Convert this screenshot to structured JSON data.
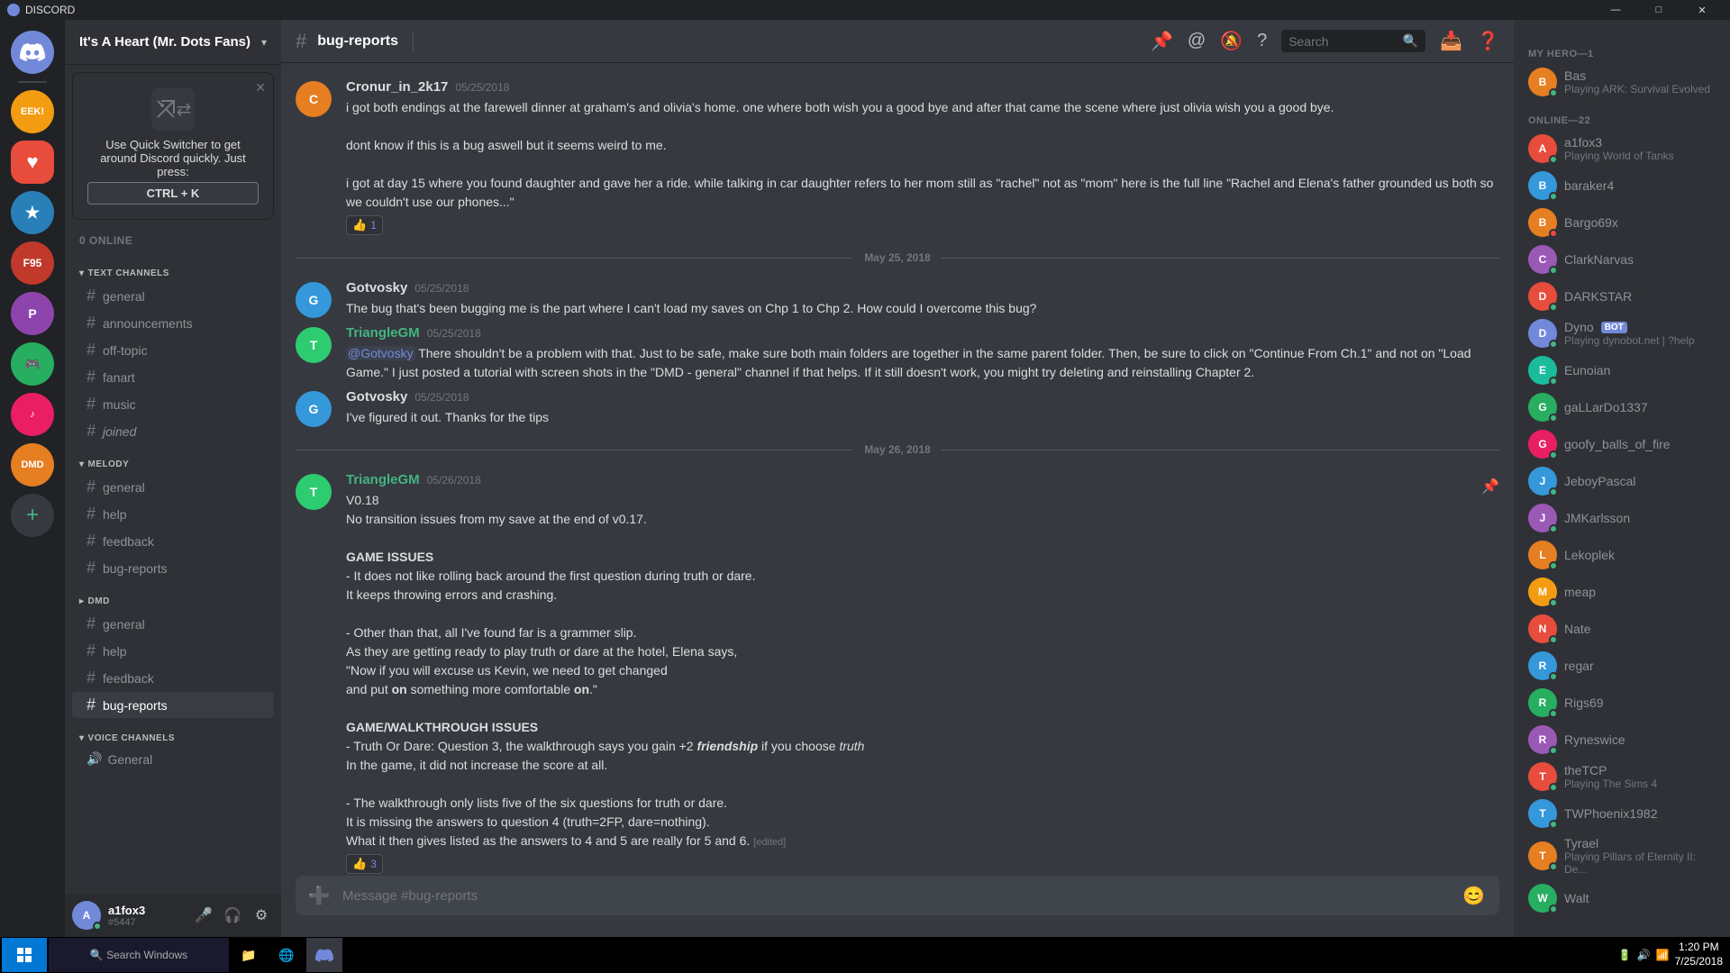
{
  "app": {
    "title": "DISCORD",
    "server_name": "It's A Heart (Mr. Dots Fans)",
    "channel": "bug-reports"
  },
  "titlebar": {
    "title": "DISCORD",
    "minimize": "—",
    "maximize": "□",
    "close": "✕"
  },
  "quick_switcher": {
    "title": "Use Quick Switcher to get around Discord quickly. Just press:",
    "shortcut": "CTRL + K"
  },
  "online_count": "0 ONLINE",
  "server_header": {
    "name": "It's A Heart (Mr. Dots Fans)",
    "arrow": "▾"
  },
  "channels": {
    "text_label": "TEXT CHANNELS",
    "melody_label": "MELODY",
    "dmd_label": "DMD",
    "voice_label": "VOICE CHANNELS",
    "text_channels": [
      {
        "name": "general",
        "active": false
      },
      {
        "name": "announcements",
        "active": false
      },
      {
        "name": "off-topic",
        "active": false
      },
      {
        "name": "fanart",
        "active": false
      },
      {
        "name": "music",
        "active": false
      },
      {
        "name": "joined",
        "active": false
      }
    ],
    "melody_channels": [
      {
        "name": "general",
        "active": false
      },
      {
        "name": "help",
        "active": false
      },
      {
        "name": "feedback",
        "active": false
      },
      {
        "name": "bug-reports",
        "active": false
      }
    ],
    "dmd_channels": [
      {
        "name": "general",
        "active": false
      },
      {
        "name": "help",
        "active": false
      },
      {
        "name": "feedback",
        "active": false
      },
      {
        "name": "bug-reports",
        "active": true
      }
    ],
    "voice_channels": [
      {
        "name": "General"
      }
    ]
  },
  "user_panel": {
    "name": "a1fox3",
    "discriminator": "#5447",
    "avatar_letter": "A"
  },
  "chat": {
    "channel_name": "bug-reports",
    "search_placeholder": "Search",
    "input_placeholder": "Message #bug-reports",
    "messages": [
      {
        "id": "msg1",
        "author": "Cronur_in_2k17",
        "author_color": "#dcddde",
        "avatar_color": "#e67e22",
        "avatar_letter": "C",
        "timestamp": "05/25/2018",
        "text": "i got both endings at the farewell dinner at graham's and olivia's home. one where both wish you a good bye and after that came the scene where just olivia wish you a good bye.\n\ndont know if this is a bug aswell but it seems weird to me.\n\ni got at day 15 where you found daughter and gave her a ride. while talking in car daughter refers to her mom still as \"rachel\" not as \"mom\" here is the full line \"Rachel and Elena's father grounded us both so we couldn't use our phones...\"",
        "reaction": "👍 1",
        "has_reaction": true
      },
      {
        "id": "msg2",
        "author": "Gotvosky",
        "author_color": "#dcddde",
        "avatar_color": "#3498db",
        "avatar_letter": "G",
        "timestamp": "05/25/2018",
        "text": "The bug that's been bugging me is the part where I can't load my saves on Chp 1 to Chp 2. How could I overcome this bug?",
        "date_before": "May 25, 2018"
      },
      {
        "id": "msg3",
        "author": "TriangleGM",
        "author_color": "#43b581",
        "avatar_color": "#43b581",
        "avatar_letter": "T",
        "timestamp": "05/25/2018",
        "text": "@Gotvosky There shouldn't be a problem with that. Just to be safe, make sure both main folders are together in the same parent folder. Then, be sure to click on \"Continue From Ch.1\" and not on \"Load Game.\" I just posted a tutorial with screen shots in the \"DMD - general\" channel if that helps. If it still doesn't work, you might try deleting and reinstalling Chapter 2.",
        "mention": "@Gotvosky"
      },
      {
        "id": "msg4",
        "author": "Gotvosky",
        "author_color": "#dcddde",
        "avatar_color": "#3498db",
        "avatar_letter": "G",
        "timestamp": "05/25/2018",
        "text": "I've figured it out. Thanks for the tips"
      },
      {
        "id": "msg5",
        "author": "TriangleGM",
        "author_color": "#43b581",
        "avatar_color": "#43b581",
        "avatar_letter": "T",
        "timestamp": "05/26/2018",
        "date_before": "May 26, 2018",
        "text": "V0.18\nNo transition issues from my save at the end of v0.17.\n\nGAME ISSUES\n- It does not like rolling back around the first question during truth or dare.\nIt keeps throwing errors and crashing.\n\n- Other than that, all I've found far is a grammer slip.\nAs they are getting ready to play truth or dare at the hotel, Elena says,\n\"Now if you will excuse us Kevin, we need to get changed\nand put on something more comfortable on.\"\n\nGAME/WALKTHROUGH ISSUES\n- Truth Or Dare: Question 3, the walkthrough says you gain +2 friendship if you choose truth\nIn the game, it did not increase the score at all.\n\n- The walkthrough only lists five of the six questions for truth or dare.\nIt is missing the answers to question 4 (truth=2FP, dare=nothing).\nWhat it then gives listed as the answers to 4 and 5 are really for 5 and 6.",
        "has_reaction": true,
        "reaction": "👍 3",
        "has_pin_icon": true
      }
    ]
  },
  "members": {
    "online_label": "MY HERO—1",
    "online_section": "ONLINE—22",
    "hero": [
      {
        "name": "Bas",
        "game": "Playing ARK: Survival Evolved",
        "color": "#e67e22",
        "letter": "B",
        "status": "online"
      }
    ],
    "online": [
      {
        "name": "a1fox3",
        "game": "Playing World of Tanks",
        "color": "#e74c3c",
        "letter": "A",
        "status": "online"
      },
      {
        "name": "baraker4",
        "color": "#3498db",
        "letter": "B",
        "status": "online"
      },
      {
        "name": "Bargo69x",
        "color": "#e67e22",
        "letter": "B",
        "status": "dnd"
      },
      {
        "name": "ClarkNarvas",
        "color": "#9b59b6",
        "letter": "C",
        "status": "online"
      },
      {
        "name": "DARKSTAR",
        "color": "#e74c3c",
        "letter": "D",
        "status": "online"
      },
      {
        "name": "Dyno",
        "game": "Playing dynobot.net | ?help",
        "color": "#7289da",
        "letter": "D",
        "status": "online",
        "is_bot": true
      },
      {
        "name": "Eunoian",
        "color": "#1abc9c",
        "letter": "E",
        "status": "online"
      },
      {
        "name": "gaLLarDo1337",
        "color": "#27ae60",
        "letter": "G",
        "status": "online"
      },
      {
        "name": "goofy_balls_of_fire",
        "color": "#e91e63",
        "letter": "G",
        "status": "online"
      },
      {
        "name": "JeboyPascal",
        "color": "#3498db",
        "letter": "J",
        "status": "online"
      },
      {
        "name": "JMKarlsson",
        "color": "#9b59b6",
        "letter": "J",
        "status": "online"
      },
      {
        "name": "Lekoplek",
        "color": "#e67e22",
        "letter": "L",
        "status": "online"
      },
      {
        "name": "meap",
        "color": "#f39c12",
        "letter": "M",
        "status": "online"
      },
      {
        "name": "Nate",
        "color": "#e74c3c",
        "letter": "N",
        "status": "online"
      },
      {
        "name": "regar",
        "color": "#3498db",
        "letter": "R",
        "status": "online"
      },
      {
        "name": "Rigs69",
        "color": "#27ae60",
        "letter": "R",
        "status": "online"
      },
      {
        "name": "Ryneswice",
        "color": "#9b59b6",
        "letter": "R",
        "status": "online"
      },
      {
        "name": "theTCP",
        "game": "Playing The Sims 4",
        "color": "#e74c3c",
        "letter": "T",
        "status": "online"
      },
      {
        "name": "TWPhoenix1982",
        "color": "#3498db",
        "letter": "T",
        "status": "online"
      },
      {
        "name": "Tyrael",
        "game": "Playing Pillars of Eternity II: De...",
        "color": "#e67e22",
        "letter": "T",
        "status": "online"
      },
      {
        "name": "Walt",
        "color": "#27ae60",
        "letter": "W",
        "status": "online"
      }
    ]
  },
  "taskbar": {
    "time": "1:20 PM",
    "date": "7/25/2018"
  }
}
